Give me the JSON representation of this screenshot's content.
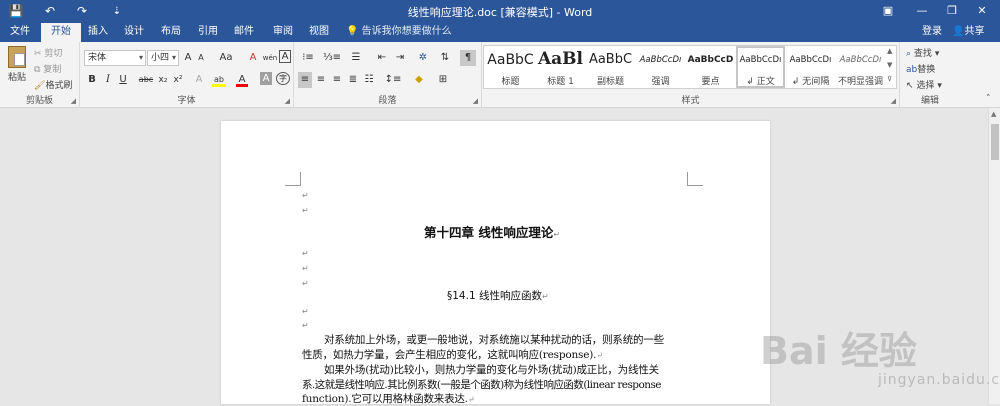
{
  "titlebar": {
    "title": "线性响应理论.doc [兼容模式] - Word",
    "save_icon": "💾",
    "undo_icon": "↶",
    "redo_icon": "↷",
    "customize_icon": "⇣",
    "ribbon_display_icon": "▣",
    "minimize_icon": "—",
    "restore_icon": "❐",
    "close_icon": "✕"
  },
  "tabs": [
    {
      "label": "文件"
    },
    {
      "label": "开始"
    },
    {
      "label": "插入"
    },
    {
      "label": "设计"
    },
    {
      "label": "布局"
    },
    {
      "label": "引用"
    },
    {
      "label": "邮件"
    },
    {
      "label": "审阅"
    },
    {
      "label": "视图"
    }
  ],
  "tell_me": "告诉我你想要做什么",
  "account": {
    "login": "登录",
    "share": "共享"
  },
  "clipboard": {
    "paste": "粘贴",
    "cut": "剪切",
    "copy": "复制",
    "format_painter": "格式刷",
    "group_label": "剪贴板"
  },
  "font": {
    "family": "宋体",
    "size": "小四",
    "grow": "A",
    "shrink": "A",
    "change_case": "Aa",
    "clear": "A",
    "phonetic": "wén",
    "border": "A",
    "bold": "B",
    "italic": "I",
    "underline": "U",
    "strike": "abc",
    "subscript": "x₂",
    "superscript": "x²",
    "effects": "A",
    "highlight": "ab",
    "color": "A",
    "shade": "A",
    "enclose": "字",
    "group_label": "字体"
  },
  "paragraph": {
    "group_label": "段落"
  },
  "styles": {
    "items": [
      {
        "preview": "AaBbC",
        "name": "标题"
      },
      {
        "preview": "AaBl",
        "name": "标题 1"
      },
      {
        "preview": "AaBbC",
        "name": "副标题"
      },
      {
        "preview": "AaBbCcDı",
        "name": "强调"
      },
      {
        "preview": "AaBbCcD",
        "name": "要点"
      },
      {
        "preview": "AaBbCcDı",
        "name": "↲ 正文"
      },
      {
        "preview": "AaBbCcDı",
        "name": "↲ 无间隔"
      },
      {
        "preview": "AaBbCcDı",
        "name": "不明显强调"
      }
    ],
    "group_label": "样式"
  },
  "editing": {
    "find": "查找",
    "replace": "替换",
    "select": "选择",
    "group_label": "编辑"
  },
  "document": {
    "para_mark": "↵",
    "chapter_title": "第十四章  线性响应理论",
    "section_title": "§14.1  线性响应函数",
    "lines": [
      "对系统加上外场，或更一般地说，对系统施以某种扰动的话，则系统的一些",
      "性质，如热力学量，会产生相应的变化，这就叫响应(response).",
      "如果外场(扰动)比较小，则热力学量的变化与外场(扰动)成正比，为线性关",
      "系.这就是线性响应.其比例系数(一般是个函数)称为线性响应函数(linear response",
      "function).它可以用格林函数来表达."
    ]
  },
  "watermark": {
    "main": "Bai  经验",
    "sub": "jingyan.baidu.com"
  }
}
